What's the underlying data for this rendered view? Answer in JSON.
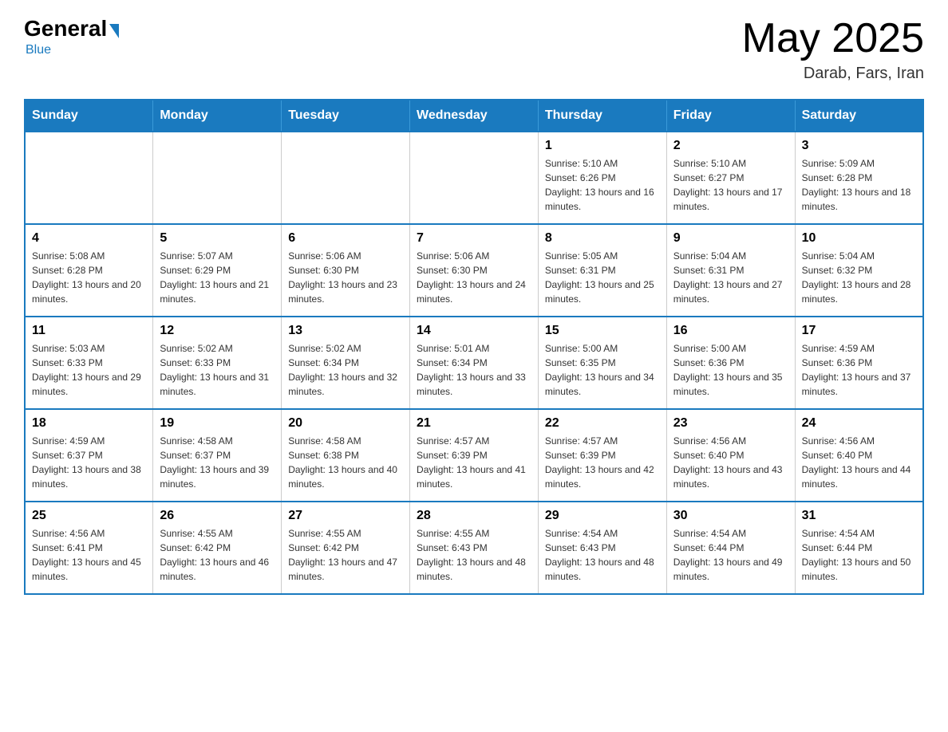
{
  "header": {
    "logo": {
      "general": "General",
      "blue": "Blue",
      "subtitle": "Blue"
    },
    "title": "May 2025",
    "location": "Darab, Fars, Iran"
  },
  "weekdays": [
    "Sunday",
    "Monday",
    "Tuesday",
    "Wednesday",
    "Thursday",
    "Friday",
    "Saturday"
  ],
  "weeks": [
    [
      {
        "day": "",
        "info": ""
      },
      {
        "day": "",
        "info": ""
      },
      {
        "day": "",
        "info": ""
      },
      {
        "day": "",
        "info": ""
      },
      {
        "day": "1",
        "info": "Sunrise: 5:10 AM\nSunset: 6:26 PM\nDaylight: 13 hours and 16 minutes."
      },
      {
        "day": "2",
        "info": "Sunrise: 5:10 AM\nSunset: 6:27 PM\nDaylight: 13 hours and 17 minutes."
      },
      {
        "day": "3",
        "info": "Sunrise: 5:09 AM\nSunset: 6:28 PM\nDaylight: 13 hours and 18 minutes."
      }
    ],
    [
      {
        "day": "4",
        "info": "Sunrise: 5:08 AM\nSunset: 6:28 PM\nDaylight: 13 hours and 20 minutes."
      },
      {
        "day": "5",
        "info": "Sunrise: 5:07 AM\nSunset: 6:29 PM\nDaylight: 13 hours and 21 minutes."
      },
      {
        "day": "6",
        "info": "Sunrise: 5:06 AM\nSunset: 6:30 PM\nDaylight: 13 hours and 23 minutes."
      },
      {
        "day": "7",
        "info": "Sunrise: 5:06 AM\nSunset: 6:30 PM\nDaylight: 13 hours and 24 minutes."
      },
      {
        "day": "8",
        "info": "Sunrise: 5:05 AM\nSunset: 6:31 PM\nDaylight: 13 hours and 25 minutes."
      },
      {
        "day": "9",
        "info": "Sunrise: 5:04 AM\nSunset: 6:31 PM\nDaylight: 13 hours and 27 minutes."
      },
      {
        "day": "10",
        "info": "Sunrise: 5:04 AM\nSunset: 6:32 PM\nDaylight: 13 hours and 28 minutes."
      }
    ],
    [
      {
        "day": "11",
        "info": "Sunrise: 5:03 AM\nSunset: 6:33 PM\nDaylight: 13 hours and 29 minutes."
      },
      {
        "day": "12",
        "info": "Sunrise: 5:02 AM\nSunset: 6:33 PM\nDaylight: 13 hours and 31 minutes."
      },
      {
        "day": "13",
        "info": "Sunrise: 5:02 AM\nSunset: 6:34 PM\nDaylight: 13 hours and 32 minutes."
      },
      {
        "day": "14",
        "info": "Sunrise: 5:01 AM\nSunset: 6:34 PM\nDaylight: 13 hours and 33 minutes."
      },
      {
        "day": "15",
        "info": "Sunrise: 5:00 AM\nSunset: 6:35 PM\nDaylight: 13 hours and 34 minutes."
      },
      {
        "day": "16",
        "info": "Sunrise: 5:00 AM\nSunset: 6:36 PM\nDaylight: 13 hours and 35 minutes."
      },
      {
        "day": "17",
        "info": "Sunrise: 4:59 AM\nSunset: 6:36 PM\nDaylight: 13 hours and 37 minutes."
      }
    ],
    [
      {
        "day": "18",
        "info": "Sunrise: 4:59 AM\nSunset: 6:37 PM\nDaylight: 13 hours and 38 minutes."
      },
      {
        "day": "19",
        "info": "Sunrise: 4:58 AM\nSunset: 6:37 PM\nDaylight: 13 hours and 39 minutes."
      },
      {
        "day": "20",
        "info": "Sunrise: 4:58 AM\nSunset: 6:38 PM\nDaylight: 13 hours and 40 minutes."
      },
      {
        "day": "21",
        "info": "Sunrise: 4:57 AM\nSunset: 6:39 PM\nDaylight: 13 hours and 41 minutes."
      },
      {
        "day": "22",
        "info": "Sunrise: 4:57 AM\nSunset: 6:39 PM\nDaylight: 13 hours and 42 minutes."
      },
      {
        "day": "23",
        "info": "Sunrise: 4:56 AM\nSunset: 6:40 PM\nDaylight: 13 hours and 43 minutes."
      },
      {
        "day": "24",
        "info": "Sunrise: 4:56 AM\nSunset: 6:40 PM\nDaylight: 13 hours and 44 minutes."
      }
    ],
    [
      {
        "day": "25",
        "info": "Sunrise: 4:56 AM\nSunset: 6:41 PM\nDaylight: 13 hours and 45 minutes."
      },
      {
        "day": "26",
        "info": "Sunrise: 4:55 AM\nSunset: 6:42 PM\nDaylight: 13 hours and 46 minutes."
      },
      {
        "day": "27",
        "info": "Sunrise: 4:55 AM\nSunset: 6:42 PM\nDaylight: 13 hours and 47 minutes."
      },
      {
        "day": "28",
        "info": "Sunrise: 4:55 AM\nSunset: 6:43 PM\nDaylight: 13 hours and 48 minutes."
      },
      {
        "day": "29",
        "info": "Sunrise: 4:54 AM\nSunset: 6:43 PM\nDaylight: 13 hours and 48 minutes."
      },
      {
        "day": "30",
        "info": "Sunrise: 4:54 AM\nSunset: 6:44 PM\nDaylight: 13 hours and 49 minutes."
      },
      {
        "day": "31",
        "info": "Sunrise: 4:54 AM\nSunset: 6:44 PM\nDaylight: 13 hours and 50 minutes."
      }
    ]
  ]
}
